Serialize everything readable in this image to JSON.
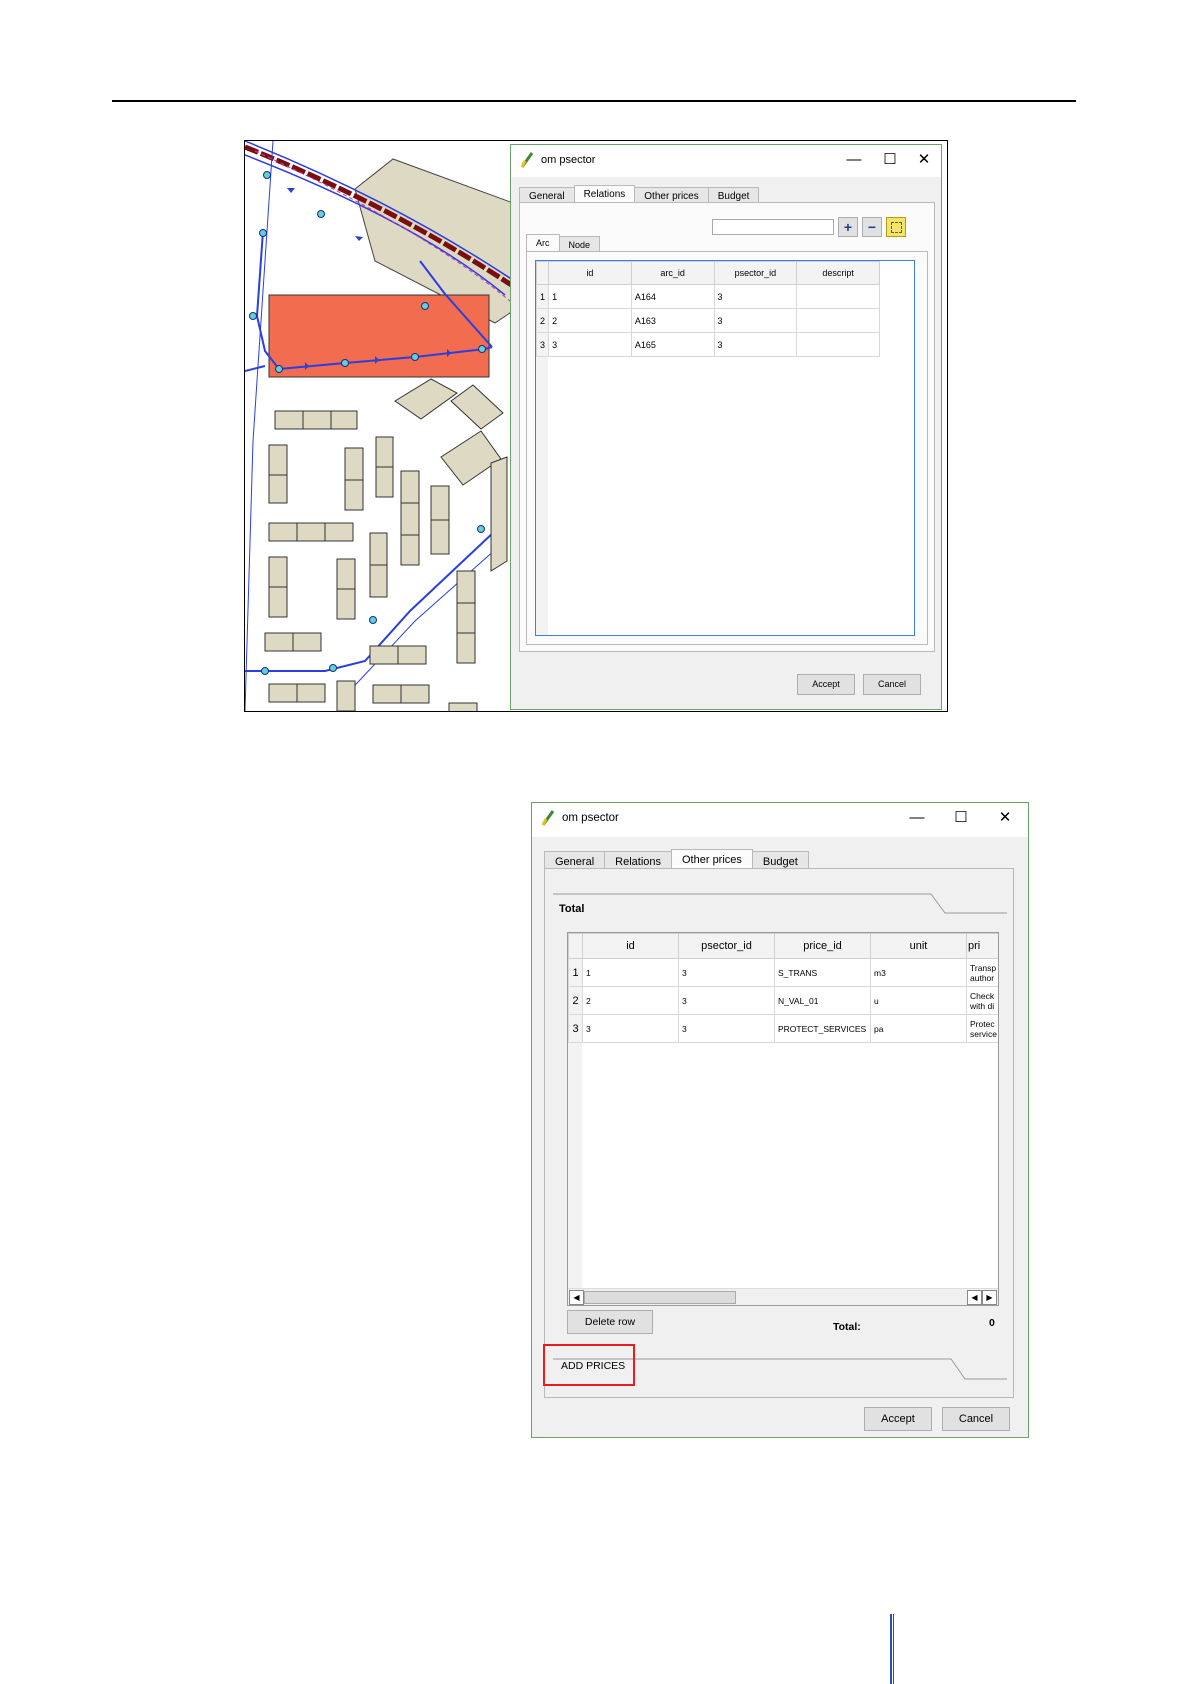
{
  "dialog1": {
    "title": "om psector",
    "tabs": [
      "General",
      "Relations",
      "Other prices",
      "Budget"
    ],
    "active_tab": "Relations",
    "subtabs": [
      "Arc",
      "Node"
    ],
    "active_subtab": "Arc",
    "filter_value": "",
    "add_symbol": "+",
    "remove_symbol": "−",
    "columns": [
      "id",
      "arc_id",
      "psector_id",
      "descript"
    ],
    "rows": [
      {
        "n": "1",
        "id": "1",
        "arc_id": "A164",
        "psector_id": "3",
        "descript": ""
      },
      {
        "n": "2",
        "id": "2",
        "arc_id": "A163",
        "psector_id": "3",
        "descript": ""
      },
      {
        "n": "3",
        "id": "3",
        "arc_id": "A165",
        "psector_id": "3",
        "descript": ""
      }
    ],
    "accept_label": "Accept",
    "cancel_label": "Cancel"
  },
  "dialog2": {
    "title": "om psector",
    "tabs": [
      "General",
      "Relations",
      "Other prices",
      "Budget"
    ],
    "active_tab": "Other prices",
    "section_title": "Total",
    "columns": [
      "id",
      "psector_id",
      "price_id",
      "unit",
      "pri"
    ],
    "rows": [
      {
        "n": "1",
        "id": "1",
        "psector_id": "3",
        "price_id": "S_TRANS",
        "unit": "m3",
        "price_a": "Transp",
        "price_b": "author"
      },
      {
        "n": "2",
        "id": "2",
        "psector_id": "3",
        "price_id": "N_VAL_01",
        "unit": "u",
        "price_a": "Check",
        "price_b": "with di"
      },
      {
        "n": "3",
        "id": "3",
        "psector_id": "3",
        "price_id": "PROTECT_SERVICES",
        "unit": "pa",
        "price_a": "Protec",
        "price_b": "service"
      }
    ],
    "delete_row_label": "Delete row",
    "total_label": "Total:",
    "total_value": "0",
    "add_prices_label": "ADD PRICES",
    "accept_label": "Accept",
    "cancel_label": "Cancel"
  },
  "window_controls": {
    "minimize": "—",
    "maximize": "☐",
    "close": "✕"
  },
  "colors": {
    "highlight_box": "#e81c1c",
    "map_line": "#2b3fe0",
    "parcel": "#f26d50",
    "building": "#ddd9c3"
  }
}
